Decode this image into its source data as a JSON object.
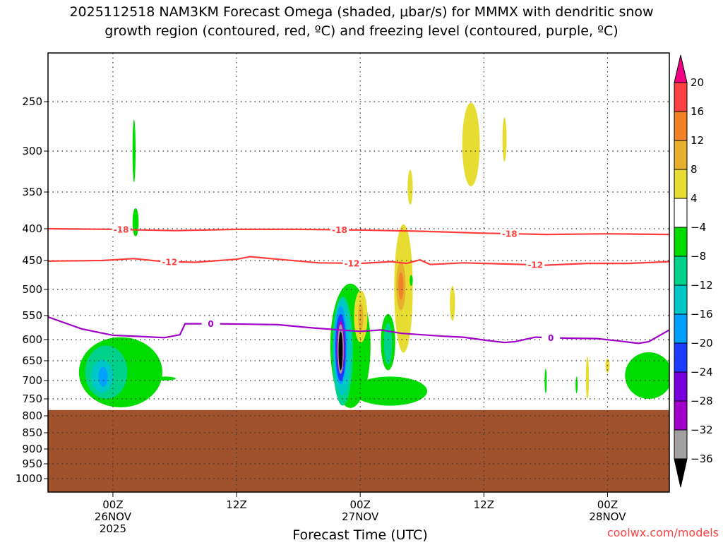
{
  "chart_data": {
    "type": "heatmap",
    "title_lines": [
      "2025112518 NAM3KM Forecast Omega (shaded, μbar/s) for MMMX with dendritic snow",
      "growth region (contoured, red, ºC) and freezing level (contoured, purple, ºC)"
    ],
    "xlabel": "Forecast Time (UTC)",
    "credit": "coolwx.com/models",
    "xlim_hours": [
      -0.3,
      60
    ],
    "x_ticks": [
      {
        "hour": 6,
        "lines": [
          "00Z",
          "26NOV",
          "2025"
        ]
      },
      {
        "hour": 18,
        "lines": [
          "12Z"
        ]
      },
      {
        "hour": 30,
        "lines": [
          "00Z",
          "27NOV"
        ]
      },
      {
        "hour": 42,
        "lines": [
          "12Z"
        ]
      },
      {
        "hour": 54,
        "lines": [
          "00Z",
          "28NOV"
        ]
      }
    ],
    "y_ticks": [
      250,
      300,
      350,
      400,
      450,
      500,
      550,
      600,
      650,
      700,
      750,
      800,
      850,
      900,
      950,
      1000
    ],
    "ground_pressure": 783,
    "colorbar": {
      "labels": [
        "20",
        "16",
        "12",
        "8",
        "4",
        "-4",
        "-8",
        "-12",
        "-16",
        "-20",
        "-24",
        "-28",
        "-32",
        "-36"
      ],
      "colors": [
        "#ff4040",
        "#f08228",
        "#e6af2d",
        "#e6dc32",
        "#ffffff",
        "#00dc00",
        "#00d28c",
        "#00c8c8",
        "#00a0ff",
        "#1e3cff",
        "#7800dc",
        "#a000c8",
        "#a0a0a0"
      ],
      "over_color": "#f00082",
      "under_color": "#000000"
    },
    "contours": [
      {
        "name": "dgz-minus18",
        "label": "-18",
        "color": "#ff3c3c",
        "label_hours": [
          6.8,
          28,
          44.5
        ],
        "points": [
          [
            -0.3,
            400
          ],
          [
            6,
            401
          ],
          [
            12,
            403
          ],
          [
            18,
            401
          ],
          [
            24,
            401
          ],
          [
            30,
            402
          ],
          [
            36,
            404
          ],
          [
            42,
            407
          ],
          [
            48,
            409
          ],
          [
            54,
            408
          ],
          [
            60,
            409
          ]
        ]
      },
      {
        "name": "dgz-minus12",
        "label": "-12",
        "color": "#ff3c3c",
        "label_hours": [
          11.5,
          29.2,
          47
        ],
        "points": [
          [
            -0.3,
            451
          ],
          [
            5,
            450
          ],
          [
            8,
            447
          ],
          [
            11,
            452
          ],
          [
            14,
            453
          ],
          [
            18,
            448
          ],
          [
            19.3,
            444
          ],
          [
            22,
            448
          ],
          [
            26,
            454
          ],
          [
            30,
            455
          ],
          [
            33,
            452
          ],
          [
            34.5,
            455
          ],
          [
            35.8,
            449
          ],
          [
            36.8,
            457
          ],
          [
            40,
            454
          ],
          [
            44,
            456
          ],
          [
            48,
            458
          ],
          [
            52,
            455
          ],
          [
            56,
            455
          ],
          [
            60,
            452
          ]
        ]
      },
      {
        "name": "freezing-level",
        "label": "0",
        "color": "#a000c8",
        "label_hours": [
          15.5,
          48.5
        ],
        "points": [
          [
            -0.3,
            553
          ],
          [
            3,
            578
          ],
          [
            6,
            591
          ],
          [
            9,
            594
          ],
          [
            11,
            596
          ],
          [
            12.5,
            590
          ],
          [
            13,
            567
          ],
          [
            16,
            567
          ],
          [
            19,
            568
          ],
          [
            22,
            569
          ],
          [
            25,
            575
          ],
          [
            28,
            580
          ],
          [
            30,
            583
          ],
          [
            32,
            580
          ],
          [
            34,
            587
          ],
          [
            38,
            593
          ],
          [
            40,
            595
          ],
          [
            42,
            601
          ],
          [
            44,
            607
          ],
          [
            45,
            605
          ],
          [
            47,
            595
          ],
          [
            50,
            597
          ],
          [
            53,
            598
          ],
          [
            55,
            603
          ],
          [
            57,
            609
          ],
          [
            58,
            605
          ],
          [
            60,
            580
          ]
        ]
      }
    ],
    "shaded_regions": [
      {
        "value": -6,
        "hours": [
          7.9,
          8.2
        ],
        "p": [
          268,
          338
        ]
      },
      {
        "value": -6,
        "hours": [
          7.9,
          8.5
        ],
        "p": [
          372,
          412
        ]
      },
      {
        "value": -6,
        "hours": [
          2.7,
          10.8
        ],
        "p": [
          595,
          775
        ]
      },
      {
        "value": -6,
        "hours": [
          10,
          12.1
        ],
        "p": [
          690,
          700
        ]
      },
      {
        "value": -10,
        "hours": [
          3.3,
          7.4
        ],
        "p": [
          614,
          750
        ]
      },
      {
        "value": -14,
        "hours": [
          3.9,
          6.0
        ],
        "p": [
          648,
          733
        ]
      },
      {
        "value": -18,
        "hours": [
          4.6,
          5.5
        ],
        "p": [
          665,
          717
        ]
      },
      {
        "value": -6,
        "hours": [
          27.1,
          31.0
        ],
        "p": [
          490,
          777
        ]
      },
      {
        "value": -6,
        "hours": [
          29.3,
          36.5
        ],
        "p": [
          690,
          770
        ]
      },
      {
        "value": -6,
        "hours": [
          32.0,
          33.4
        ],
        "p": [
          547,
          674
        ]
      },
      {
        "value": -10,
        "hours": [
          32.3,
          33.1
        ],
        "p": [
          565,
          660
        ]
      },
      {
        "value": -10,
        "hours": [
          27.3,
          29.3
        ],
        "p": [
          513,
          770
        ]
      },
      {
        "value": -14,
        "hours": [
          27.4,
          29.1
        ],
        "p": [
          519,
          740
        ]
      },
      {
        "value": -18,
        "hours": [
          27.5,
          28.7
        ],
        "p": [
          532,
          711
        ]
      },
      {
        "value": -22,
        "hours": [
          27.6,
          28.6
        ],
        "p": [
          547,
          702
        ]
      },
      {
        "value": -30,
        "hours": [
          27.7,
          28.5
        ],
        "p": [
          561,
          683
        ]
      },
      {
        "value": -34,
        "hours": [
          27.8,
          28.4
        ],
        "p": [
          568,
          683
        ]
      },
      {
        "value": -40,
        "hours": [
          27.9,
          28.3
        ],
        "p": [
          583,
          674
        ]
      },
      {
        "value": 6,
        "hours": [
          29.4,
          30.7
        ],
        "p": [
          502,
          607
        ]
      },
      {
        "value": 10,
        "hours": [
          29.8,
          30.3
        ],
        "p": [
          526,
          583
        ]
      },
      {
        "value": 6,
        "hours": [
          33.3,
          35.1
        ],
        "p": [
          394,
          631
        ]
      },
      {
        "value": 10,
        "hours": [
          33.5,
          34.4
        ],
        "p": [
          451,
          540
        ]
      },
      {
        "value": 14,
        "hours": [
          33.7,
          34.2
        ],
        "p": [
          470,
          520
        ]
      },
      {
        "value": 6,
        "hours": [
          34.6,
          35.1
        ],
        "p": [
          323,
          367
        ]
      },
      {
        "value": -6,
        "hours": [
          34.8,
          35.1
        ],
        "p": [
          475,
          494
        ]
      },
      {
        "value": 6,
        "hours": [
          39.9,
          41.6
        ],
        "p": [
          251,
          343
        ]
      },
      {
        "value": 6,
        "hours": [
          43.8,
          44.2
        ],
        "p": [
          266,
          313
        ]
      },
      {
        "value": 6,
        "hours": [
          38.7,
          39.2
        ],
        "p": [
          494,
          561
        ]
      },
      {
        "value": -6,
        "hours": [
          55.7,
          60.3
        ],
        "p": [
          630,
          750
        ]
      },
      {
        "value": 6,
        "hours": [
          51.9,
          52.2
        ],
        "p": [
          640,
          750
        ]
      },
      {
        "value": 6,
        "hours": [
          53.8,
          54.2
        ],
        "p": [
          645,
          680
        ]
      },
      {
        "value": -6,
        "hours": [
          47.9,
          48.1
        ],
        "p": [
          670,
          735
        ]
      },
      {
        "value": -6,
        "hours": [
          50.9,
          51.1
        ],
        "p": [
          690,
          735
        ]
      }
    ]
  }
}
